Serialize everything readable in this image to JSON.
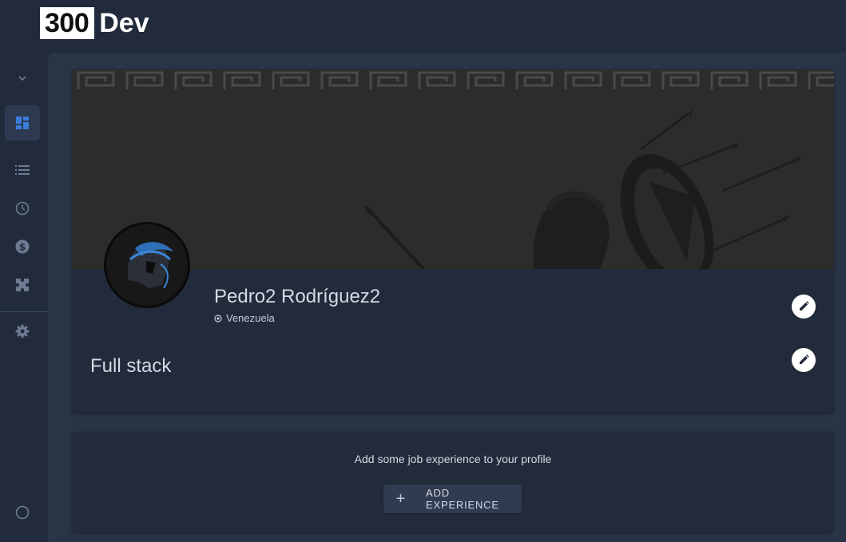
{
  "app": {
    "logo_number": "300",
    "logo_suffix": "Dev"
  },
  "sidebar": {
    "items": [
      {
        "icon": "chevron-down-icon"
      },
      {
        "icon": "dashboard-icon",
        "active": true
      },
      {
        "icon": "list-icon"
      },
      {
        "icon": "clock-icon"
      },
      {
        "icon": "dollar-icon"
      },
      {
        "icon": "puzzle-icon"
      },
      {
        "icon": "gear-icon"
      },
      {
        "icon": "circle-icon"
      }
    ]
  },
  "profile": {
    "name": "Pedro2 Rodríguez2",
    "location": "Venezuela",
    "headline": "Full stack"
  },
  "experience": {
    "empty_message": "Add some job experience to your profile",
    "add_button_label": "ADD EXPERIENCE"
  },
  "colors": {
    "background": "#212a3b",
    "card": "#222b3b",
    "accent": "#3b7ddd",
    "banner": "#2c2c2c"
  }
}
